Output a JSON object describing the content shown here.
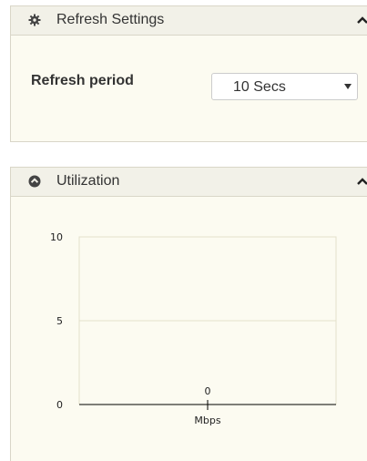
{
  "refresh_panel": {
    "title": "Refresh Settings",
    "header_icon": "gear-icon",
    "collapse_icon": "chevron-up-icon",
    "refresh_label": "Refresh period",
    "refresh_select": {
      "value": "10 Secs"
    }
  },
  "util_panel": {
    "title": "Utilization",
    "header_icon": "circle-arrow-up-icon",
    "collapse_icon": "chevron-up-icon"
  },
  "chart_data": {
    "type": "bar",
    "categories": [
      "Mbps"
    ],
    "values": [
      0
    ],
    "data_labels": [
      "0"
    ],
    "title": "",
    "xlabel": "",
    "ylabel": "",
    "ylim": [
      0,
      10
    ],
    "yticks": [
      "0",
      "5",
      "10"
    ],
    "grid": true
  },
  "colors": {
    "panel_bg": "#fcfbf1",
    "header_bg": "#f2f1e8",
    "border": "#d9d6c8",
    "gridline": "#e3e0cc",
    "axis": "#000000",
    "text": "#333333"
  }
}
